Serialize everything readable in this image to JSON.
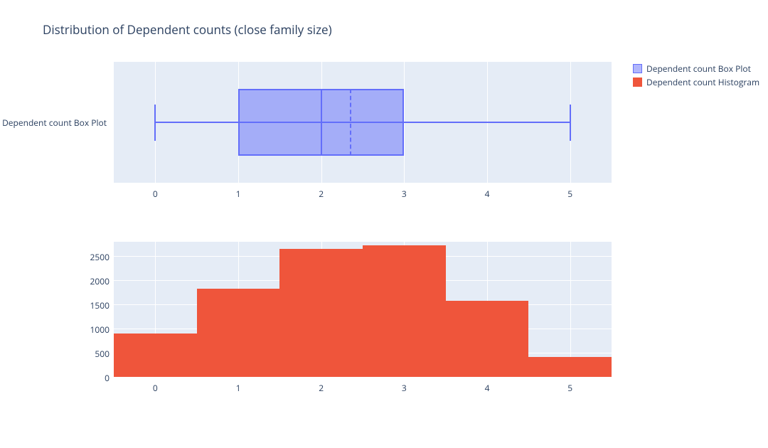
{
  "title": "Distribution of Dependent counts (close family size)",
  "legend": {
    "items": [
      {
        "label": "Dependent count Box Plot",
        "fill": "rgba(99,110,250,0.5)",
        "border": "#636efa"
      },
      {
        "label": "Dependent count Histogram",
        "fill": "#ef553b",
        "border": "#ef553b"
      }
    ]
  },
  "chart_data": [
    {
      "type": "box",
      "title": "",
      "xlabel": "",
      "ylabel": "",
      "xlim": [
        -0.5,
        5.5
      ],
      "x_ticks": [
        0,
        1,
        2,
        3,
        4,
        5
      ],
      "y_category_label": "Dependent count Box Plot",
      "box": {
        "min": 0,
        "q1": 1,
        "median": 2,
        "mean": 2.35,
        "q3": 3,
        "max": 5
      }
    },
    {
      "type": "bar",
      "title": "",
      "xlabel": "",
      "ylabel": "",
      "xlim": [
        -0.5,
        5.5
      ],
      "ylim": [
        0,
        2800
      ],
      "x_ticks": [
        0,
        1,
        2,
        3,
        4,
        5
      ],
      "y_ticks": [
        0,
        500,
        1000,
        1500,
        2000,
        2500
      ],
      "categories": [
        0,
        1,
        2,
        3,
        4,
        5
      ],
      "values": [
        900,
        1830,
        2650,
        2730,
        1570,
        420
      ]
    }
  ]
}
